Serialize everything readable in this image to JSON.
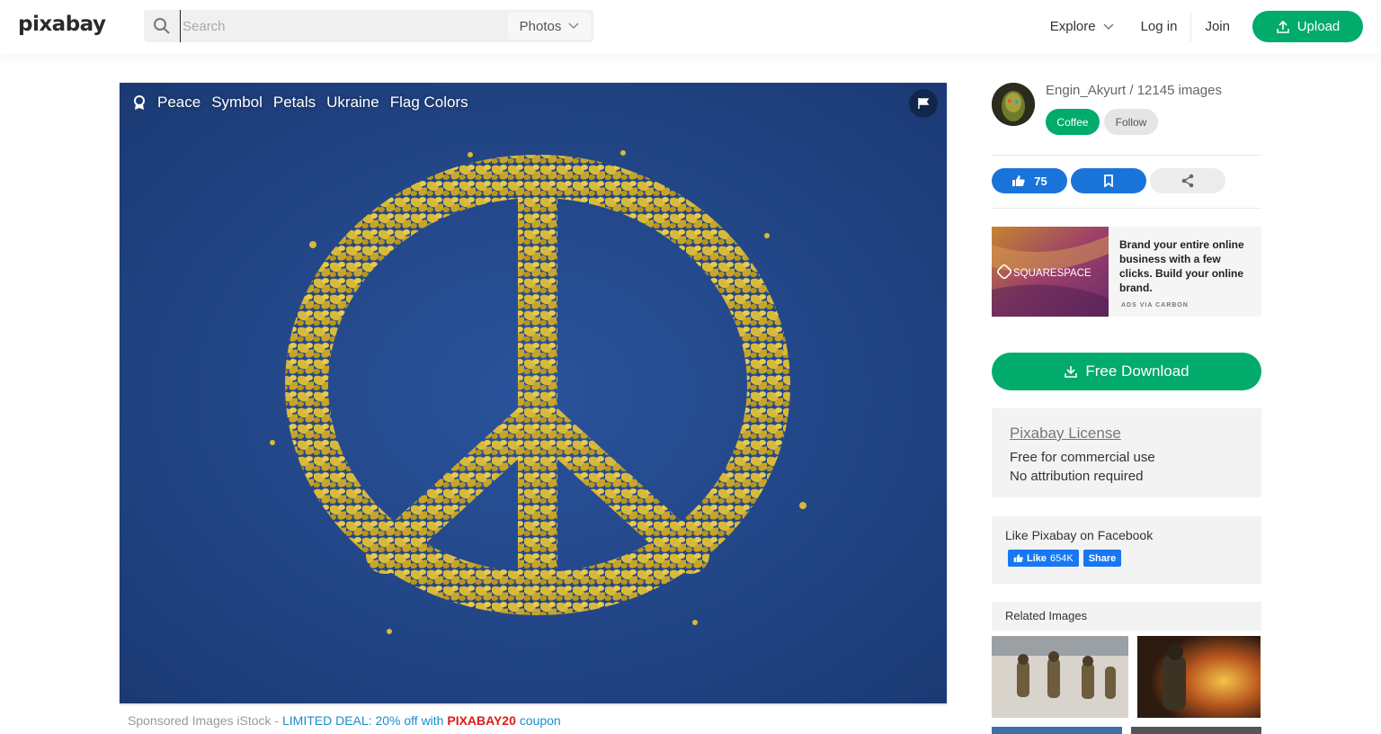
{
  "header": {
    "logo": "pixabay",
    "search": {
      "placeholder": "Search",
      "type_selected": "Photos"
    },
    "nav": {
      "explore": "Explore",
      "login": "Log in",
      "join": "Join",
      "upload": "Upload"
    }
  },
  "photo": {
    "tags": [
      "Peace",
      "Symbol",
      "Petals",
      "Ukraine",
      "Flag Colors"
    ]
  },
  "sponsored": {
    "prefix": "Sponsored Images iStock - ",
    "deal": "LIMITED DEAL: 20% off with ",
    "code": "PIXABAY20",
    "suffix": " coupon"
  },
  "author": {
    "line": "Engin_Akyurt / 12145 images",
    "coffee": "Coffee",
    "follow": "Follow"
  },
  "actions": {
    "likes": "75"
  },
  "ad": {
    "brand": "SQUARESPACE",
    "text": "Brand your entire online business with a few clicks. Build your online brand.",
    "via": "ADS VIA CARBON"
  },
  "download": {
    "label": "Free Download"
  },
  "license": {
    "title": "Pixabay License",
    "line1": "Free for commercial use",
    "line2": "No attribution required"
  },
  "facebook": {
    "title": "Like Pixabay on Facebook",
    "like": "Like",
    "count": "654K",
    "share": "Share"
  },
  "related": {
    "title": "Related Images"
  },
  "colors": {
    "accent": "#00ab6b",
    "blue": "#1a73d9",
    "photo_bg": "#22478a",
    "petal": "#d9b93a"
  }
}
